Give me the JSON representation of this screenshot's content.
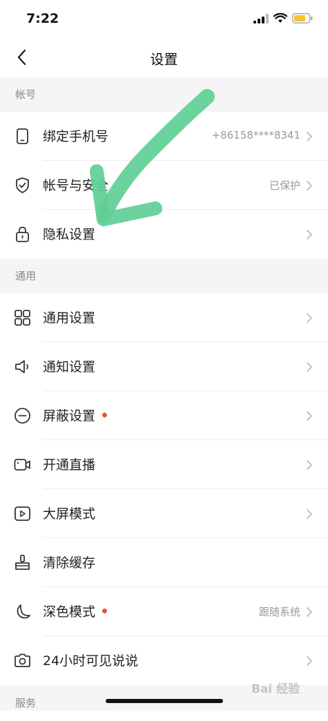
{
  "status_bar": {
    "time": "7:22"
  },
  "nav": {
    "title": "设置"
  },
  "sections": [
    {
      "header": "帐号"
    },
    {
      "header": "通用"
    },
    {
      "header": "服务"
    }
  ],
  "account": {
    "phone": {
      "label": "绑定手机号",
      "value": "+86158****8341"
    },
    "security": {
      "label": "帐号与安全",
      "value": "已保护"
    },
    "privacy": {
      "label": "隐私设置"
    }
  },
  "general": {
    "general_settings": {
      "label": "通用设置"
    },
    "notifications": {
      "label": "通知设置"
    },
    "blocking": {
      "label": "屏蔽设置"
    },
    "live": {
      "label": "开通直播"
    },
    "big_screen": {
      "label": "大屏模式"
    },
    "clear_cache": {
      "label": "清除缓存"
    },
    "dark_mode": {
      "label": "深色模式",
      "value": "跟随系统"
    },
    "moments_24h": {
      "label": "24小时可见说说"
    }
  },
  "watermark": {
    "text": "Bai 经验"
  },
  "icons": {
    "accent_red": "#e8542a",
    "arrow_color": "#5fcf96"
  }
}
